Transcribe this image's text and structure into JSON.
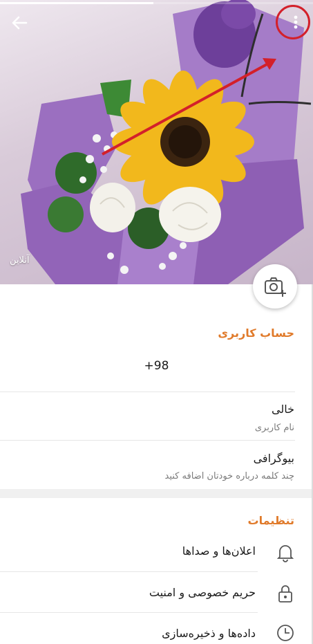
{
  "status": {
    "online": "آنلاین"
  },
  "account": {
    "title": "حساب کاربری",
    "phone": "+98",
    "username_value": "خالی",
    "username_label": "نام کاربری",
    "bio_title": "بیوگرافی",
    "bio_hint": "چند کلمه درباره خودتان اضافه کنید"
  },
  "settings": {
    "title": "تنظیمات",
    "items": [
      {
        "label": "اعلان‌ها و صداها",
        "icon": "bell-icon"
      },
      {
        "label": "حریم خصوصی و امنیت",
        "icon": "lock-icon"
      },
      {
        "label": "داده‌ها و ذخیره‌سازی",
        "icon": "clock-icon"
      }
    ]
  },
  "colors": {
    "accent": "#e07a2a",
    "annotation": "#d3202a"
  },
  "story_progress": 0.49
}
